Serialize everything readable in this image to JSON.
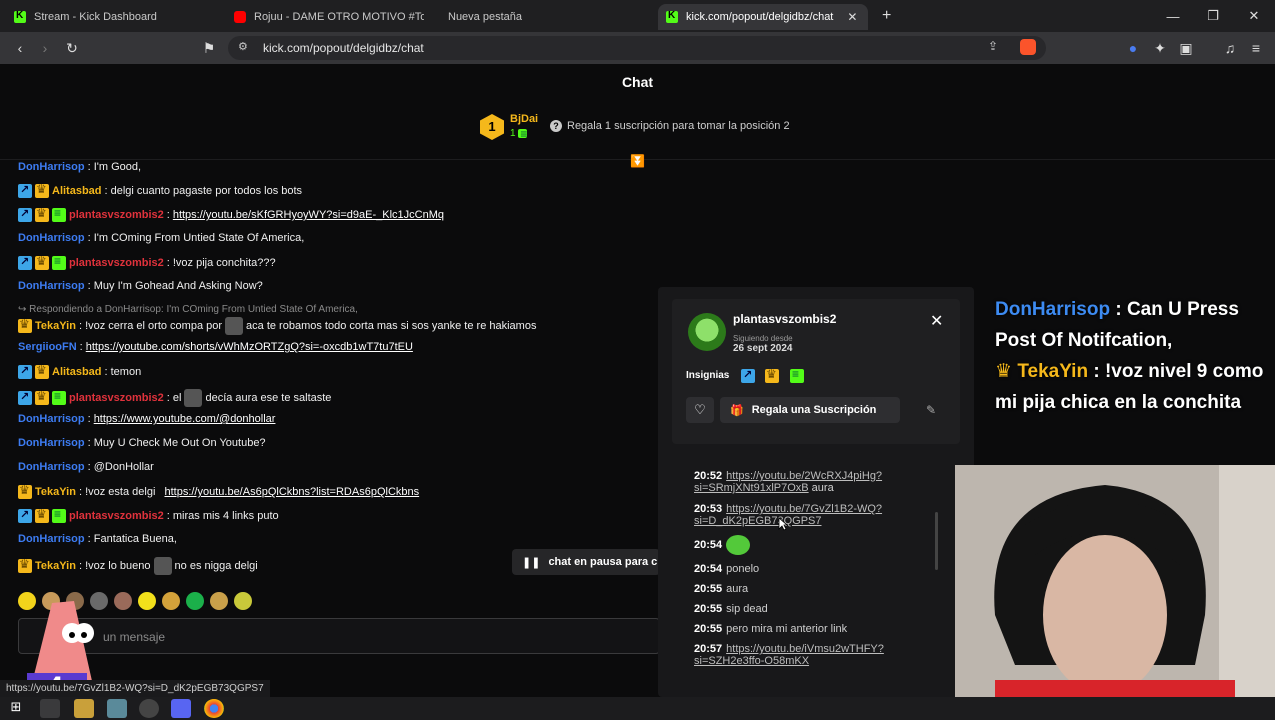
{
  "browser": {
    "tabs": [
      {
        "title": "Stream - Kick Dashboard",
        "icon": "kick-icon"
      },
      {
        "title": "Rojuu - DAME OTRO MOTIVO #Tony",
        "icon": "youtube-icon"
      },
      {
        "title": "Nueva pestaña",
        "icon": "none"
      },
      {
        "title": "kick.com/popout/delgidbz/chat",
        "icon": "kick-icon",
        "active": true
      }
    ],
    "url": "kick.com/popout/delgidbz/chat",
    "new_tab": "+",
    "close": "✕",
    "minimize": "—",
    "maximize": "❐",
    "window_close": "✕"
  },
  "chat": {
    "header": "Chat",
    "leaderboard": {
      "rank": "1",
      "name": "BjDai",
      "count": "1",
      "gift_prompt": "Regala 1 suscripción para tomar la posición 2"
    },
    "messages": [
      {
        "user": "DonHarrisop",
        "color": "blue",
        "badges": [],
        "text": ": I'm Good,"
      },
      {
        "user": "Alitasbad",
        "color": "gold",
        "badges": [
          "pin",
          "crown"
        ],
        "text": ": delgi cuanto pagaste por todos los bots"
      },
      {
        "user": "plantasvszombis2",
        "color": "red",
        "badges": [
          "pin",
          "crown",
          "sub"
        ],
        "text": ": ",
        "link": "https://youtu.be/sKfGRHyoyWY?si=d9aE-_Klc1JcCnMq"
      },
      {
        "user": "DonHarrisop",
        "color": "blue",
        "badges": [],
        "text": ": I'm COming From Untied State Of America,"
      },
      {
        "user": "plantasvszombis2",
        "color": "red",
        "badges": [
          "pin",
          "crown",
          "sub"
        ],
        "text": ": !voz pija conchita???"
      },
      {
        "user": "DonHarrisop",
        "color": "blue",
        "badges": [],
        "text": ": Muy I'm Gohead And Asking Now?"
      },
      {
        "user": "TekaYin",
        "color": "gold",
        "badges": [
          "crown"
        ],
        "text": ": !voz cerra el orto compa por",
        "text2": "aca te robamos todo corta mas si sos yanke te re hakiamos"
      },
      {
        "user": "SergiiooFN",
        "color": "green",
        "badges": [],
        "text": ": ",
        "link": "https://youtube.com/shorts/vWhMzORTZgQ?si=-oxcdb1wT7tu7tEU"
      },
      {
        "user": "Alitasbad",
        "color": "gold",
        "badges": [
          "pin",
          "crown"
        ],
        "text": ": temon"
      },
      {
        "user": "plantasvszombis2",
        "color": "red",
        "badges": [
          "pin",
          "crown",
          "sub"
        ],
        "text": ": el",
        "text2": "decía aura ese te saltaste"
      },
      {
        "user": "DonHarrisop",
        "color": "blue",
        "badges": [],
        "text": ": ",
        "link": "https://www.youtube.com/@donhollar"
      },
      {
        "user": "DonHarrisop",
        "color": "blue",
        "badges": [],
        "text": ": Muy U Check Me Out On Youtube?"
      },
      {
        "user": "DonHarrisop",
        "color": "blue",
        "badges": [],
        "text": ": @DonHollar"
      },
      {
        "user": "TekaYin",
        "color": "gold",
        "badges": [
          "crown"
        ],
        "text": ": !voz esta delgi",
        "link": "https://youtu.be/As6pQlCkbns?list=RDAs6pQlCkbns"
      },
      {
        "user": "plantasvszombis2",
        "color": "red",
        "badges": [
          "pin",
          "crown",
          "sub"
        ],
        "text": ": miras mis 4 links puto"
      },
      {
        "user": "DonHarrisop",
        "color": "blue",
        "badges": [],
        "text": ": Fantatica Buena,"
      },
      {
        "user": "TekaYin",
        "color": "gold",
        "badges": [
          "crown"
        ],
        "text": ": !voz lo bueno",
        "text2": "no es nigga delgi"
      }
    ],
    "reply_note": "Respondiendo a DonHarrisop: I'm COming From Untied State Of America,",
    "paused": "chat en pausa para c",
    "input_placeholder": "un mensaje",
    "status_url": "https://youtu.be/7GvZl1B2-WQ?si=D_dK2pEGB73QGPS7"
  },
  "user_card": {
    "username": "plantasvszombis2",
    "following_label": "Siguiendo desde",
    "following_date": "26 sept 2024",
    "badges_label": "Insignias",
    "gift_button": "Regala una Suscripción",
    "close": "✕",
    "heart": "♡",
    "log": [
      {
        "time": "20:52",
        "link": "https://youtu.be/2WcRXJ4piHg?",
        "link2": "si=SRmjXNt91xlP7OxB",
        "suffix": " aura"
      },
      {
        "time": "20:53",
        "link": "https://youtu.be/7GvZl1B2-WQ?",
        "link2": "si=D_dK2pEGB73QGPS7",
        "suffix": ""
      },
      {
        "time": "20:54",
        "text": ""
      },
      {
        "time": "20:54",
        "text": "ponelo"
      },
      {
        "time": "20:55",
        "text": "aura"
      },
      {
        "time": "20:55",
        "text": "sip dead"
      },
      {
        "time": "20:55",
        "text": "pero mira mi anterior link"
      },
      {
        "time": "20:57",
        "link": "https://youtu.be/iVmsu2wTHFY?",
        "link2": "si=SZH2e3ffo-O58mKX",
        "suffix": ""
      }
    ]
  },
  "overlay": {
    "line1_user": "DonHarrisop",
    "line1_text": " : Can U Press Post Of Notifcation,",
    "line2_user": "TekaYin",
    "line2_text": " : !voz nivel 9 como mi pija chica en la conchita"
  },
  "colors": {
    "kick_green": "#53fc18",
    "user_blue": "#3d7cf2",
    "user_gold": "#f5b81b",
    "user_red": "#e0323c"
  }
}
